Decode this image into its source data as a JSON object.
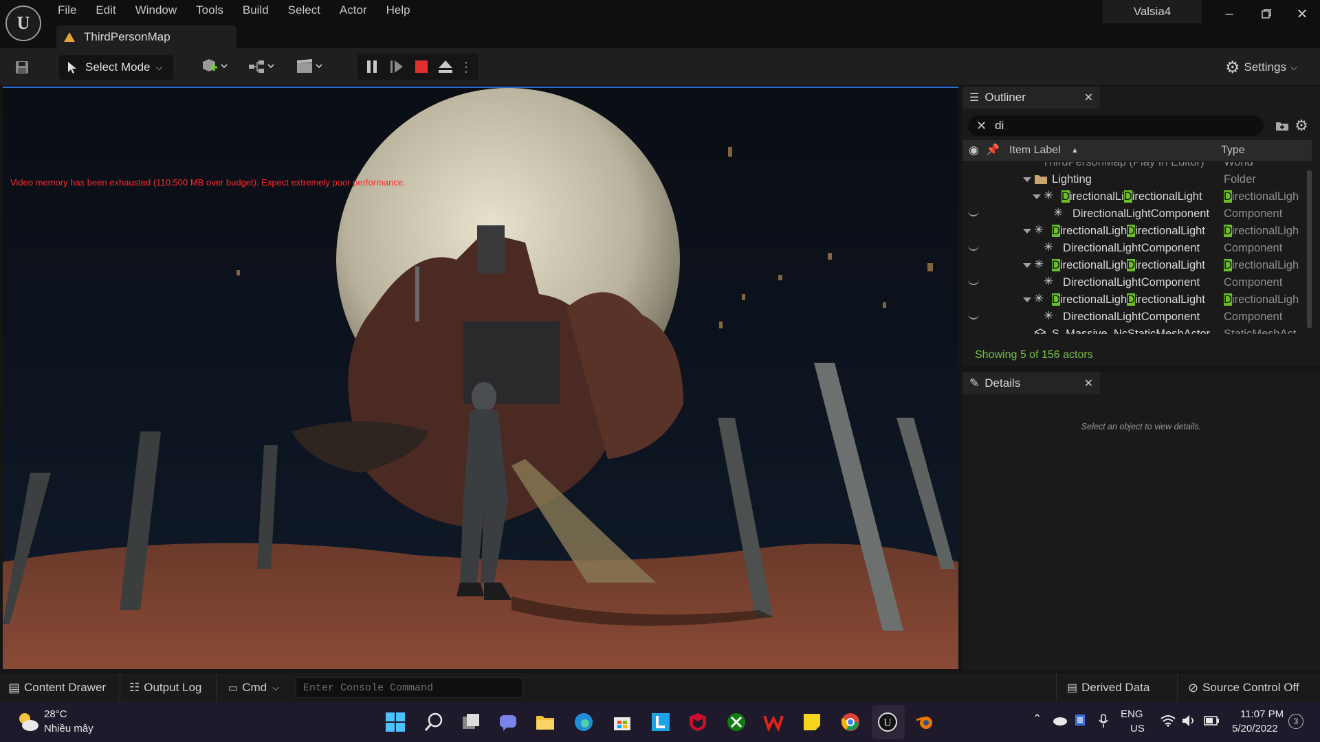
{
  "window": {
    "menus": [
      "File",
      "Edit",
      "Window",
      "Tools",
      "Build",
      "Select",
      "Actor",
      "Help"
    ],
    "map_tab": "ThirdPersonMap",
    "profile": "Valsia4"
  },
  "toolbar": {
    "select_mode": "Select Mode",
    "settings": "Settings"
  },
  "viewport": {
    "warning": "Video memory has been exhausted (110.500 MB over budget). Expect extremely poor performance."
  },
  "outliner": {
    "title": "Outliner",
    "search_value": "di",
    "col_label": "Item Label",
    "col_type": "Type",
    "rows": [
      {
        "label": "ThirdPersonMap (Play In Editor)",
        "type": "World"
      },
      {
        "label": "Lighting",
        "type": "Folder"
      },
      {
        "pre": "",
        "hl1": "D",
        "mid": "irectionalLi",
        "hl2": "D",
        "post": "irectionalLight",
        "thl": "D",
        "type": "irectionalLigh"
      },
      {
        "label": "DirectionalLightComponent",
        "type": "Component"
      },
      {
        "pre": "",
        "hl1": "D",
        "mid": "irectionalLigh",
        "hl2": "D",
        "post": "irectionalLight",
        "thl": "D",
        "type": "irectionalLigh"
      },
      {
        "label": "DirectionalLightComponent",
        "type": "Component"
      },
      {
        "pre": "",
        "hl1": "D",
        "mid": "irectionalLigh",
        "hl2": "D",
        "post": "irectionalLight",
        "thl": "D",
        "type": "irectionalLigh"
      },
      {
        "label": "DirectionalLightComponent",
        "type": "Component"
      },
      {
        "pre": "",
        "hl1": "D",
        "mid": "irectionalLigh",
        "hl2": "D",
        "post": "irectionalLight",
        "thl": "D",
        "type": "irectionalLigh"
      },
      {
        "label": "DirectionalLightComponent",
        "type": "Component"
      },
      {
        "label": "S_Massive_NcStaticMeshActor",
        "type": "StaticMeshAct"
      }
    ],
    "showing": "Showing 5 of 156 actors"
  },
  "details": {
    "title": "Details",
    "hint": "Select an object to view details."
  },
  "statusbar": {
    "content_drawer": "Content Drawer",
    "output_log": "Output Log",
    "cmd": "Cmd",
    "console_placeholder": "Enter Console Command",
    "derived_data": "Derived Data",
    "source_control": "Source Control Off"
  },
  "taskbar": {
    "temp": "28°C",
    "weather": "Nhiều mây",
    "lang1": "ENG",
    "lang2": "US",
    "time": "11:07 PM",
    "date": "5/20/2022",
    "notif": "3"
  }
}
